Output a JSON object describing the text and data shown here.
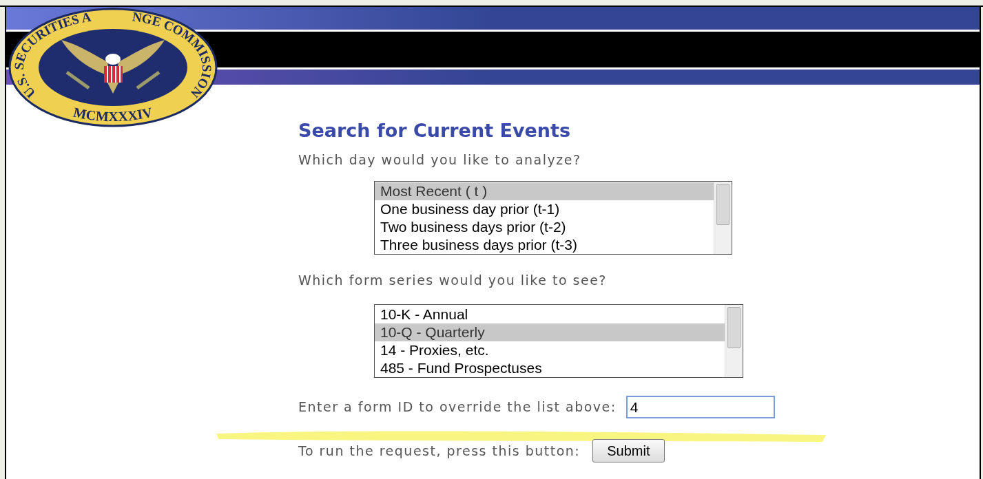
{
  "seal": {
    "ring_texts": [
      "U.S. SECURITIES A",
      "NGE COMMISSION"
    ],
    "motto": "MCMXXXIV"
  },
  "title": "Search for Current Events",
  "day_question": "Which day would you like to analyze?",
  "day_options": [
    {
      "label": "Most Recent ( t )",
      "selected": true
    },
    {
      "label": "One business day prior (t-1)",
      "selected": false
    },
    {
      "label": "Two business days prior (t-2)",
      "selected": false
    },
    {
      "label": "Three business days prior (t-3)",
      "selected": false
    }
  ],
  "form_question": "Which form series would you like to see?",
  "form_options": [
    {
      "label": "10-K - Annual",
      "selected": false
    },
    {
      "label": "10-Q - Quarterly",
      "selected": true
    },
    {
      "label": "14 - Proxies, etc.",
      "selected": false
    },
    {
      "label": "485 - Fund Prospectuses",
      "selected": false
    }
  ],
  "override": {
    "label": "Enter a form ID to override the list above:",
    "value": "4"
  },
  "submit": {
    "label": "To run the request, press this button:",
    "button": "Submit"
  }
}
